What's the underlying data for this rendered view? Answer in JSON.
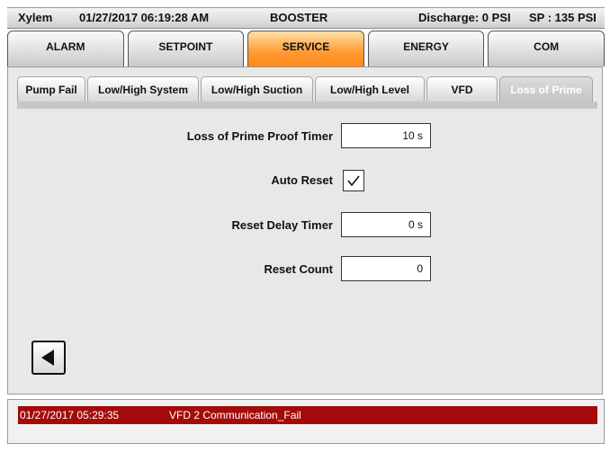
{
  "header": {
    "brand": "Xylem",
    "datetime": "01/27/2017 06:19:28 AM",
    "mode": "BOOSTER",
    "discharge": "Discharge: 0 PSI",
    "setpoint": "SP : 135 PSI"
  },
  "main_tabs": [
    "ALARM",
    "SETPOINT",
    "SERVICE",
    "ENERGY",
    "COM"
  ],
  "active_main_tab": "SERVICE",
  "sub_tabs": [
    "Pump Fail",
    "Low/High System",
    "Low/High Suction",
    "Low/High Level",
    "VFD",
    "Loss of Prime"
  ],
  "active_sub_tab": "Loss of Prime",
  "form": {
    "loss_of_prime_timer": {
      "label": "Loss of Prime Proof Timer",
      "value": "10 s"
    },
    "auto_reset": {
      "label": "Auto Reset",
      "checked": true
    },
    "reset_delay_timer": {
      "label": "Reset Delay Timer",
      "value": "0 s"
    },
    "reset_count": {
      "label": "Reset Count",
      "value": "0"
    }
  },
  "alarm": {
    "timestamp": "01/27/2017 05:29:35",
    "message": "VFD 2 Communication_Fail"
  },
  "colors": {
    "active_tab": "#ff9933",
    "alarm_bg": "#a50a0a"
  },
  "icons": {
    "back": "back-arrow-icon",
    "check": "checkmark-icon"
  }
}
